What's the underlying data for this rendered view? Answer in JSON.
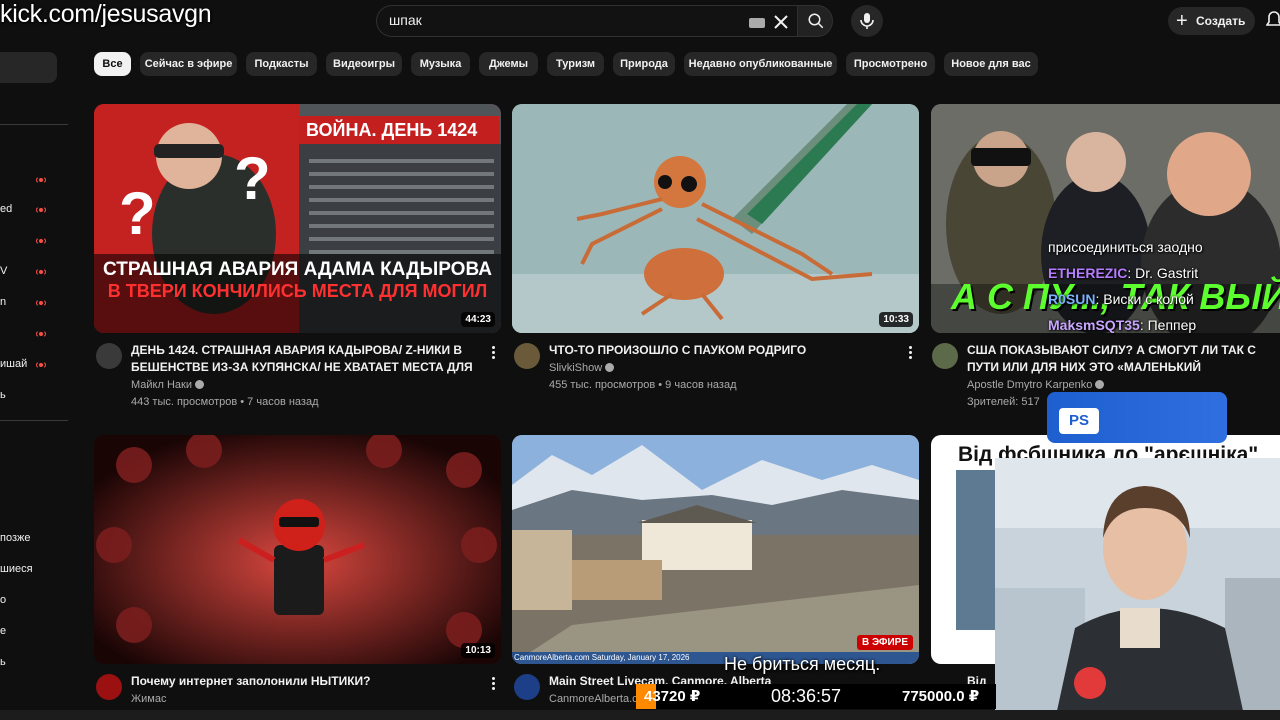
{
  "watermark": "kick.com/jesusavgn",
  "search": {
    "query": "шпак"
  },
  "header": {
    "create_label": "Создать"
  },
  "sidebar": {
    "fragments": [
      "ed",
      "V",
      "n",
      "ишай",
      "ь",
      "позже",
      "шиеся",
      "о",
      "е",
      "ь"
    ]
  },
  "chips": [
    "Все",
    "Сейчас в эфире",
    "Подкасты",
    "Видеоигры",
    "Музыка",
    "Джемы",
    "Туризм",
    "Природа",
    "Недавно опубликованные",
    "Просмотрено",
    "Новое для вас"
  ],
  "videos": [
    {
      "thumb_text": [
        "ВОЙНА. ДЕНЬ 1424",
        "СТРАШНАЯ АВАРИЯ АДАМА КАДЫРОВА",
        "В ТВЕРИ КОНЧИЛИСЬ МЕСТА ДЛЯ МОГИЛ"
      ],
      "duration": "44:23",
      "title": "ДЕНЬ 1424. СТРАШНАЯ АВАРИЯ КАДЫРОВА/ Z-НИКИ В БЕШЕНСТВЕ ИЗ-ЗА КУПЯНСКА/ НЕ ХВАТАЕТ МЕСТА ДЛЯ ...",
      "channel": "Майкл Наки",
      "meta": "443 тыс. просмотров • 7 часов назад"
    },
    {
      "duration": "10:33",
      "title": "ЧТО-ТО ПРОИЗОШЛО С ПАУКОМ РОДРИГО",
      "channel": "SlivkiShow",
      "meta": "455 тыс. просмотров • 9 часов назад"
    },
    {
      "thumb_text": [
        "А С ПУ..., ТАК ВЫЙДЕ"
      ],
      "title": "США ПОКАЗЫВАЮТ СИЛУ? А СМОГУТ ЛИ ТАК С ПУТИ ИЛИ ДЛЯ НИХ ЭТО «МАЛЕНЬКИЙ КОНФЛИКТ»?",
      "channel": "Apostle Dmytro Karpenko",
      "meta": "Зрителей: 517"
    },
    {
      "duration": "10:13",
      "title": "Почему интернет заполонили НЫТИКИ?",
      "channel": "Жимас"
    },
    {
      "live": "В ЭФИРЕ",
      "cam_caption": "CanmoreAlberta.com Saturday, January 17, 2026",
      "title": "Main Street Livecam, Canmore, Alberta",
      "channel": "CanmoreAlberta.c"
    },
    {
      "thumb_text": [
        "Від фсбшника до \"арєшніка\""
      ],
      "title": "Від"
    }
  ],
  "chat": [
    {
      "user": "",
      "text": "присоединиться заодно",
      "color": "#ffffff"
    },
    {
      "user": "ETHEREZIC",
      "text": ": Dr. Gastrit",
      "color": "#b57cff"
    },
    {
      "user": "R0SUN",
      "text": ": Виски с колой",
      "color": "#7ab3ff"
    },
    {
      "user": "MaksmSQT35",
      "text": ": Пеппер",
      "color": "#c9a6ff"
    }
  ],
  "ps_badge": "PS",
  "subtitle": "Не бриться месяц.",
  "donation": {
    "left": "43720 ₽",
    "time": "08:36:57",
    "right": "775000.0 ₽"
  },
  "colors": {
    "bg": "#0f0f0f",
    "chip": "#272727",
    "live": "#cc0000",
    "ps": "#1e5fcf"
  }
}
